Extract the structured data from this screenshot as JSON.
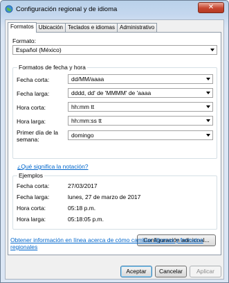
{
  "window": {
    "title": "Configuración regional y de idioma",
    "close_label": "✕"
  },
  "tabs": [
    {
      "label": "Formatos"
    },
    {
      "label": "Ubicación"
    },
    {
      "label": "Teclados e idiomas"
    },
    {
      "label": "Administrativo"
    }
  ],
  "format": {
    "label": "Formato:",
    "value": "Español (México)"
  },
  "datetime": {
    "title": "Formatos de fecha y hora",
    "fields": [
      {
        "label": "Fecha corta:",
        "value": "dd/MM/aaaa"
      },
      {
        "label": "Fecha larga:",
        "value": "dddd, dd' de 'MMMM' de 'aaaa"
      },
      {
        "label": "Hora corta:",
        "value": "hh:mm tt"
      },
      {
        "label": "Hora larga:",
        "value": "hh:mm:ss tt"
      },
      {
        "label_line1": "Primer día de la",
        "label_line2": "semana:",
        "value": "domingo"
      }
    ]
  },
  "notation_link": "¿Qué significa la notación?",
  "examples": {
    "title": "Ejemplos",
    "rows": [
      {
        "label": "Fecha corta:",
        "value": "27/03/2017"
      },
      {
        "label": "Fecha larga:",
        "value": "lunes, 27 de marzo de 2017"
      },
      {
        "label": "Hora corta:",
        "value": "05:18 p.m."
      },
      {
        "label": "Hora larga:",
        "value": "05:18:05 p.m."
      }
    ]
  },
  "additional_button": "Configuración adicional...",
  "online_link_line1": "Obtener información en línea acerca de cómo cambiar idiomas y formatos",
  "online_link_line2": "regionales",
  "footer": {
    "ok": "Aceptar",
    "cancel": "Cancelar",
    "apply": "Aplicar"
  }
}
